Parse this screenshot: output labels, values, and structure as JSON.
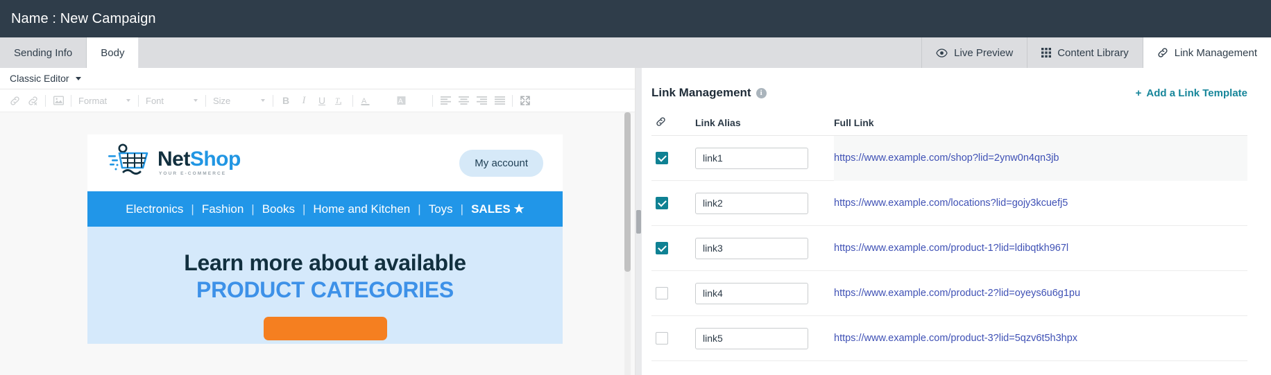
{
  "titlebar": {
    "text": "Name : New Campaign"
  },
  "tabs": {
    "left": [
      {
        "label": "Sending Info",
        "active": false
      },
      {
        "label": "Body",
        "active": true
      }
    ],
    "right": [
      {
        "label": "Live Preview",
        "icon": "eye-icon",
        "active": false
      },
      {
        "label": "Content Library",
        "icon": "grid-icon",
        "active": false
      },
      {
        "label": "Link Management",
        "icon": "link-icon",
        "active": true
      }
    ]
  },
  "editor": {
    "mode_label": "Classic Editor",
    "toolbar": {
      "link_icon": "link-icon",
      "unlink_icon": "unlink-icon",
      "image_icon": "image-icon",
      "format_label": "Format",
      "font_label": "Font",
      "size_label": "Size",
      "bold_label": "B",
      "italic_label": "I",
      "underline_label": "U",
      "remove_format_icon": "remove-format-icon",
      "text_color_label": "A",
      "bg_color_label": "A",
      "align_left_icon": "align-left-icon",
      "align_center_icon": "align-center-icon",
      "align_right_icon": "align-right-icon",
      "align_justify_icon": "align-justify-icon",
      "fullscreen_icon": "fullscreen-icon"
    }
  },
  "email": {
    "logo": {
      "name_part1": "Net",
      "name_part2": "Shop",
      "tagline": "YOUR E-COMMERCE",
      "icon": "shopping-cart-icon"
    },
    "account_button": "My account",
    "nav_items": [
      "Electronics",
      "Fashion",
      "Books",
      "Home and Kitchen",
      "Toys"
    ],
    "nav_sales": "SALES ★",
    "nav_separator": "|",
    "hero_line1": "Learn more about available",
    "hero_line2": "PRODUCT CATEGORIES",
    "hero_button": ""
  },
  "link_management": {
    "title": "Link Management",
    "info_icon": "info-icon",
    "info_glyph": "i",
    "add_template_label": "Add a Link Template",
    "add_template_plus": "+",
    "columns": {
      "checkbox": "link-icon",
      "alias": "Link Alias",
      "full_link": "Full Link"
    },
    "rows": [
      {
        "checked": true,
        "alias": "link1",
        "full_link": "https://www.example.com/shop?lid=2ynw0n4qn3jb"
      },
      {
        "checked": true,
        "alias": "link2",
        "full_link": "https://www.example.com/locations?lid=gojy3kcuefj5"
      },
      {
        "checked": true,
        "alias": "link3",
        "full_link": "https://www.example.com/product-1?lid=ldibqtkh967l"
      },
      {
        "checked": false,
        "alias": "link4",
        "full_link": "https://www.example.com/product-2?lid=oyeys6u6g1pu"
      },
      {
        "checked": false,
        "alias": "link5",
        "full_link": "https://www.example.com/product-3?lid=5qzv6t5h3hpx"
      }
    ]
  },
  "colors": {
    "titlebar_bg": "#2f3d4a",
    "tabstrip_bg": "#dcdde0",
    "accent_teal": "#17869a",
    "checkbox_checked": "#0f8193",
    "link_blue": "#3f51b5",
    "email_nav_blue": "#2196e8",
    "email_hero_bg": "#d5e9fb",
    "cta_orange": "#f57f20"
  }
}
